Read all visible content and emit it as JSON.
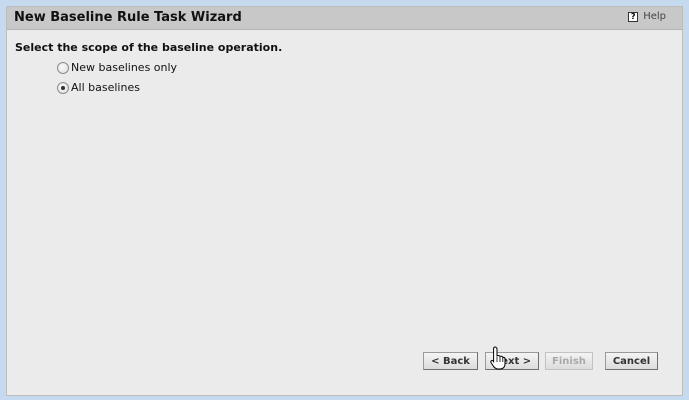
{
  "window": {
    "title": "New Baseline Rule Task Wizard",
    "help_label": "Help",
    "help_icon": "?"
  },
  "main": {
    "prompt": "Select the scope of the baseline operation.",
    "options": [
      {
        "label": "New baselines only",
        "selected": false
      },
      {
        "label": "All baselines",
        "selected": true
      }
    ]
  },
  "buttons": {
    "back": "< Back",
    "next": "Next >",
    "finish": "Finish",
    "cancel": "Cancel"
  },
  "state": {
    "finish_enabled": false,
    "cursor": "hand-pointer"
  },
  "colors": {
    "frame": "#c5d9ef",
    "titlebar": "#c8c8c8",
    "body": "#ebebeb"
  }
}
